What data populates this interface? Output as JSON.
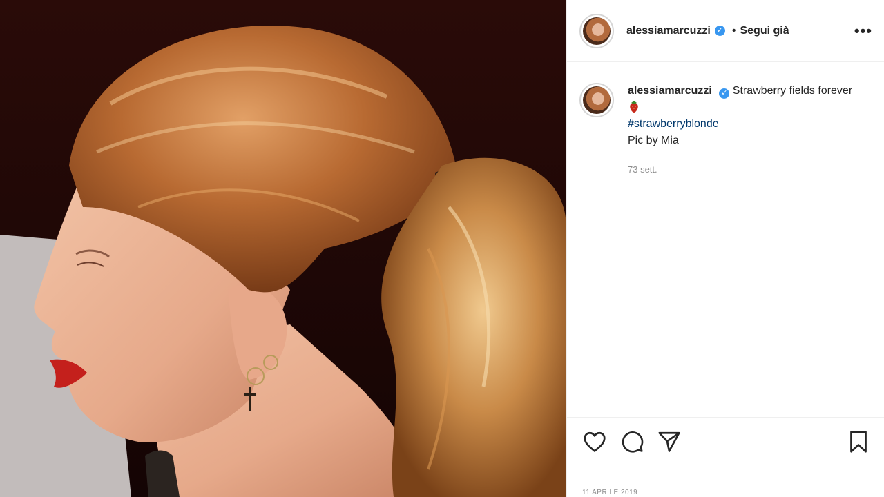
{
  "post": {
    "username": "alessiamarcuzzi",
    "verified": true,
    "follow_separator": "•",
    "follow_label": "Segui già",
    "more_label": "•••",
    "caption": {
      "username": "alessiamarcuzzi",
      "text": "Strawberry fields forever",
      "emoji": "strawberry",
      "hashtag": "#strawberryblonde",
      "credit": "Pic by Mia",
      "time": "73 sett."
    },
    "date": "11 APRILE 2019"
  },
  "icons": {
    "like": "heart-icon",
    "comment": "comment-icon",
    "share": "paper-plane-icon",
    "save": "bookmark-icon",
    "verified": "verified-badge-icon"
  },
  "colors": {
    "verified_blue": "#3897f0",
    "hashtag": "#00376b",
    "muted": "#8e8e8e"
  }
}
